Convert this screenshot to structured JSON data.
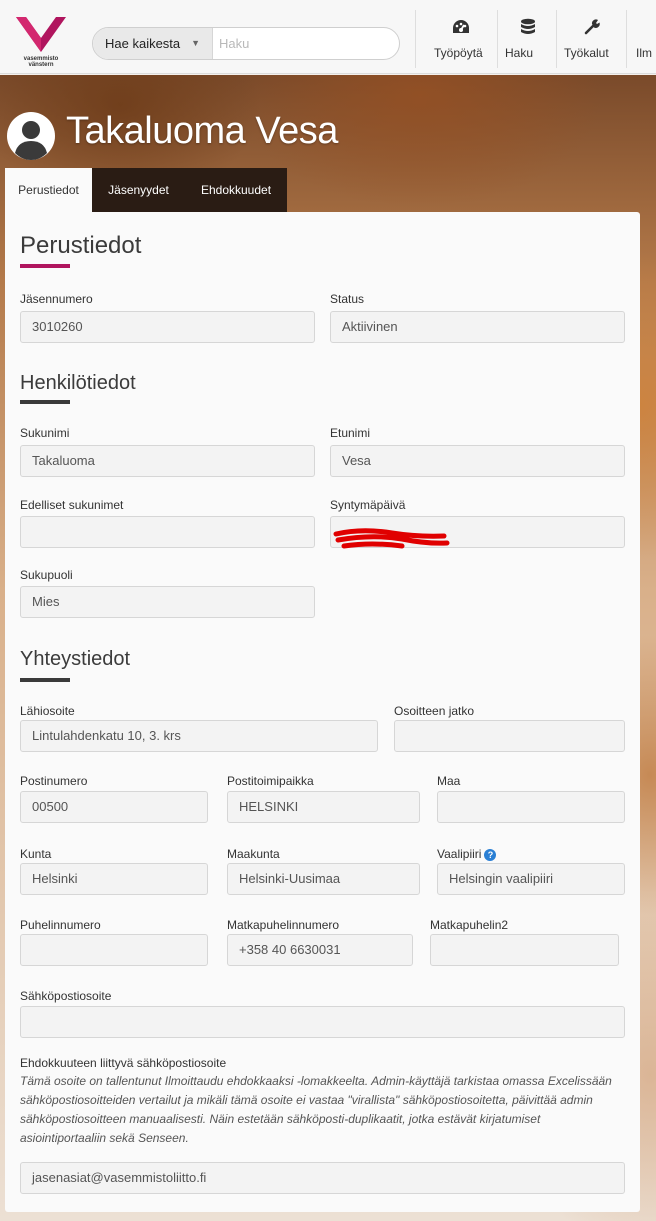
{
  "colors": {
    "brand": "#b0155e",
    "accent_underline_dark": "#3a3a3a",
    "help_icon": "#2a7fd4"
  },
  "header": {
    "logo_text_1": "vasemmisto",
    "logo_text_2": "vänstern",
    "search_scope": "Hae kaikesta",
    "search_placeholder": "Haku",
    "nav": [
      {
        "icon": "dashboard-icon",
        "label": "Työpöytä"
      },
      {
        "icon": "database-icon",
        "label": "Haku"
      },
      {
        "icon": "wrench-icon",
        "label": "Työkalut"
      },
      {
        "icon": "",
        "label": "Ilm"
      }
    ]
  },
  "page": {
    "title": "Takaluoma Vesa",
    "tabs": [
      {
        "label": "Perustiedot",
        "active": true
      },
      {
        "label": "Jäsenyydet"
      },
      {
        "label": "Ehdokkuudet"
      }
    ]
  },
  "perustiedot": {
    "heading": "Perustiedot",
    "jasennumero_label": "Jäsennumero",
    "jasennumero": "3010260",
    "status_label": "Status",
    "status": "Aktiivinen"
  },
  "henkilotiedot": {
    "heading": "Henkilötiedot",
    "sukunimi_label": "Sukunimi",
    "sukunimi": "Takaluoma",
    "etunimi_label": "Etunimi",
    "etunimi": "Vesa",
    "edelliset_label": "Edelliset sukunimet",
    "edelliset": "",
    "syntymapaiva_label": "Syntymäpäivä",
    "syntymapaiva": "",
    "sukupuoli_label": "Sukupuoli",
    "sukupuoli": "Mies"
  },
  "yhteystiedot": {
    "heading": "Yhteystiedot",
    "lahiosoite_label": "Lähiosoite",
    "lahiosoite": "Lintulahdenkatu 10, 3. krs",
    "osoitteen_jatko_label": "Osoitteen jatko",
    "osoitteen_jatko": "",
    "postinumero_label": "Postinumero",
    "postinumero": "00500",
    "postitoimipaikka_label": "Postitoimipaikka",
    "postitoimipaikka": "HELSINKI",
    "maa_label": "Maa",
    "maa": "",
    "kunta_label": "Kunta",
    "kunta": "Helsinki",
    "maakunta_label": "Maakunta",
    "maakunta": "Helsinki-Uusimaa",
    "vaalipiiri_label": "Vaalipiiri",
    "vaalipiiri": "Helsingin vaalipiiri",
    "puhelin_label": "Puhelinnumero",
    "puhelin": "",
    "matkapuhelin_label": "Matkapuhelinnumero",
    "matkapuhelin": "+358 40 6630031",
    "matkapuhelin2_label": "Matkapuhelin2",
    "matkapuhelin2": "",
    "sahkoposti_label": "Sähköpostiosoite",
    "sahkoposti": "",
    "ehdokas_email_label": "Ehdokkuuteen liittyvä sähköpostiosoite",
    "ehdokas_email_note": "Tämä osoite on tallentunut Ilmoittaudu ehdokkaaksi -lomakkeelta. Admin-käyttäjä tarkistaa omassa Excelissään sähköpostiosoitteiden vertailut ja mikäli tämä osoite ei vastaa \"virallista\" sähköpostiosoitetta, päivittää admin sähköpostiosoitteen manuaalisesti. Näin estetään sähköposti-duplikaatit, jotka estävät kirjatumiset asiointiportaaliin sekä Senseen.",
    "ehdokas_email": "jasenasiat@vasemmistoliitto.fi"
  }
}
